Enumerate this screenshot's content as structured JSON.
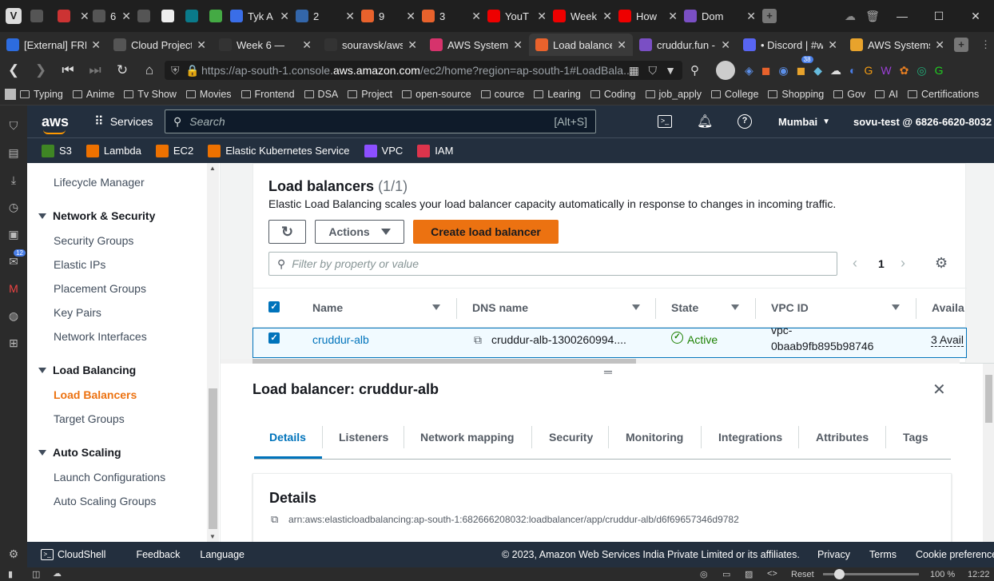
{
  "browser_tabs_row1": [
    {
      "label": "",
      "color": "#555"
    },
    {
      "label": "",
      "color": "#c33"
    },
    {
      "label": "6",
      "color": "#555"
    },
    {
      "label": "",
      "color": "#555"
    },
    {
      "label": "",
      "color": "#eee"
    },
    {
      "label": "",
      "color": "#0a7a8a"
    },
    {
      "label": "",
      "color": "#4a4"
    },
    {
      "label": "Tyk A",
      "color": "#3a6ee8"
    },
    {
      "label": "2",
      "color": "#36a"
    },
    {
      "label": "9",
      "color": "#e8622c"
    },
    {
      "label": "3",
      "color": "#e8622c"
    },
    {
      "label": "YouT",
      "color": "#e00"
    },
    {
      "label": "Week",
      "color": "#e00"
    },
    {
      "label": "How",
      "color": "#e00"
    },
    {
      "label": "Dom",
      "color": "#7a4fc4"
    }
  ],
  "browser_tabs_row2": [
    {
      "label": "[External] FREE",
      "color": "#2d6cdf"
    },
    {
      "label": "Cloud Project",
      "color": "#555"
    },
    {
      "label": "Week 6 —",
      "color": "#333"
    },
    {
      "label": "souravsk/aws-",
      "color": "#333"
    },
    {
      "label": "AWS Systems",
      "color": "#d6336c"
    },
    {
      "label": "Load balancer",
      "color": "#e8622c"
    },
    {
      "label": "cruddur.fun -",
      "color": "#7a4fc4"
    },
    {
      "label": "• Discord | #w",
      "color": "#5865f2"
    },
    {
      "label": "AWS Systems",
      "color": "#e8a32c"
    }
  ],
  "address_bar": {
    "prefix": "https://ap-south-1.console.",
    "domain": "aws.amazon.com",
    "suffix": "/ec2/home?region=ap-south-1#LoadBala..."
  },
  "extension_badge": "38",
  "bookmarks": [
    "Typing",
    "Anime",
    "Tv Show",
    "Movies",
    "Frontend",
    "DSA",
    "Project",
    "open-source",
    "cource",
    "Learing",
    "Coding",
    "job_apply",
    "College",
    "Shopping",
    "Gov",
    "AI",
    "Certifications"
  ],
  "vsidebar_badge": "12",
  "aws_nav": {
    "logo": "aws",
    "services": "Services",
    "search_placeholder": "Search",
    "search_shortcut": "[Alt+S]",
    "region": "Mumbai",
    "account": "sovu-test @ 6826-6620-8032"
  },
  "favorites": [
    {
      "label": "S3",
      "color": "#3f8624"
    },
    {
      "label": "Lambda",
      "color": "#ed7100"
    },
    {
      "label": "EC2",
      "color": "#ed7100"
    },
    {
      "label": "Elastic Kubernetes Service",
      "color": "#ed7100"
    },
    {
      "label": "VPC",
      "color": "#8c4fff"
    },
    {
      "label": "IAM",
      "color": "#dd344c"
    }
  ],
  "left_nav": {
    "top_item": "Lifecycle Manager",
    "sections": [
      {
        "title": "Network & Security",
        "items": [
          "Security Groups",
          "Elastic IPs",
          "Placement Groups",
          "Key Pairs",
          "Network Interfaces"
        ]
      },
      {
        "title": "Load Balancing",
        "items": [
          "Load Balancers",
          "Target Groups"
        ]
      },
      {
        "title": "Auto Scaling",
        "items": [
          "Launch Configurations",
          "Auto Scaling Groups"
        ]
      }
    ]
  },
  "lb_panel": {
    "title": "Load balancers",
    "count": "(1/1)",
    "description": "Elastic Load Balancing scales your load balancer capacity automatically in response to changes in incoming traffic.",
    "actions_label": "Actions",
    "create_label": "Create load balancer",
    "filter_placeholder": "Filter by property or value",
    "page": "1",
    "columns": [
      "Name",
      "DNS name",
      "State",
      "VPC ID",
      "Availa"
    ],
    "row": {
      "name": "cruddur-alb",
      "dns": "cruddur-alb-1300260994....",
      "state": "Active",
      "vpc_line1": "vpc-",
      "vpc_line2": "0baab9fb895b98746",
      "az": "3 Avail"
    }
  },
  "detail": {
    "title": "Load balancer: cruddur-alb",
    "tabs": [
      "Details",
      "Listeners",
      "Network mapping",
      "Security",
      "Monitoring",
      "Integrations",
      "Attributes",
      "Tags"
    ],
    "section_title": "Details",
    "arn": "arn:aws:elasticloadbalancing:ap-south-1:682666208032:loadbalancer/app/cruddur-alb/d6f69657346d9782"
  },
  "footer": {
    "cloudshell": "CloudShell",
    "feedback": "Feedback",
    "language": "Language",
    "copyright": "© 2023, Amazon Web Services India Private Limited or its affiliates.",
    "privacy": "Privacy",
    "terms": "Terms",
    "cookie": "Cookie preference"
  },
  "taskbar": {
    "reset": "Reset",
    "zoom": "100 %",
    "time": "12:22"
  },
  "colors": {
    "aws_nav": "#232f3e",
    "accent": "#ec7211",
    "link": "#0073bb",
    "active_green": "#1d8102"
  }
}
